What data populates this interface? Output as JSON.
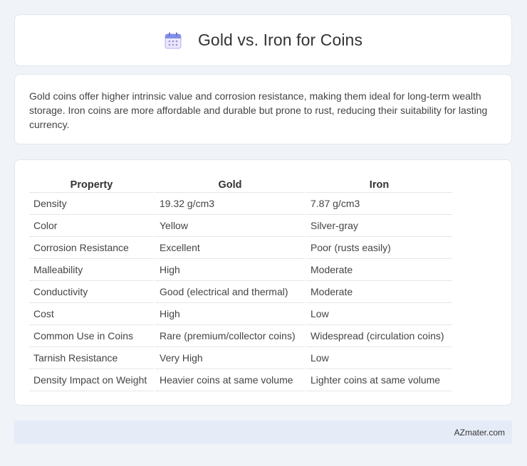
{
  "header": {
    "title": "Gold vs. Iron for Coins",
    "icon": "calendar-icon"
  },
  "summary": {
    "text": "Gold coins offer higher intrinsic value and corrosion resistance, making them ideal for long-term wealth storage. Iron coins are more affordable and durable but prone to rust, reducing their suitability for lasting currency."
  },
  "table": {
    "headers": [
      "Property",
      "Gold",
      "Iron"
    ],
    "rows": [
      [
        "Density",
        "19.32 g/cm3",
        "7.87 g/cm3"
      ],
      [
        "Color",
        "Yellow",
        "Silver-gray"
      ],
      [
        "Corrosion Resistance",
        "Excellent",
        "Poor (rusts easily)"
      ],
      [
        "Malleability",
        "High",
        "Moderate"
      ],
      [
        "Conductivity",
        "Good (electrical and thermal)",
        "Moderate"
      ],
      [
        "Cost",
        "High",
        "Low"
      ],
      [
        "Common Use in Coins",
        "Rare (premium/collector coins)",
        "Widespread (circulation coins)"
      ],
      [
        "Tarnish Resistance",
        "Very High",
        "Low"
      ],
      [
        "Density Impact on Weight",
        "Heavier coins at same volume",
        "Lighter coins at same volume"
      ]
    ]
  },
  "footer": {
    "text": "AZmater.com"
  },
  "colors": {
    "background": "#f0f3f8",
    "card": "#ffffff",
    "footer": "#e6ecf7",
    "icon_accent": "#8a7bd9"
  }
}
